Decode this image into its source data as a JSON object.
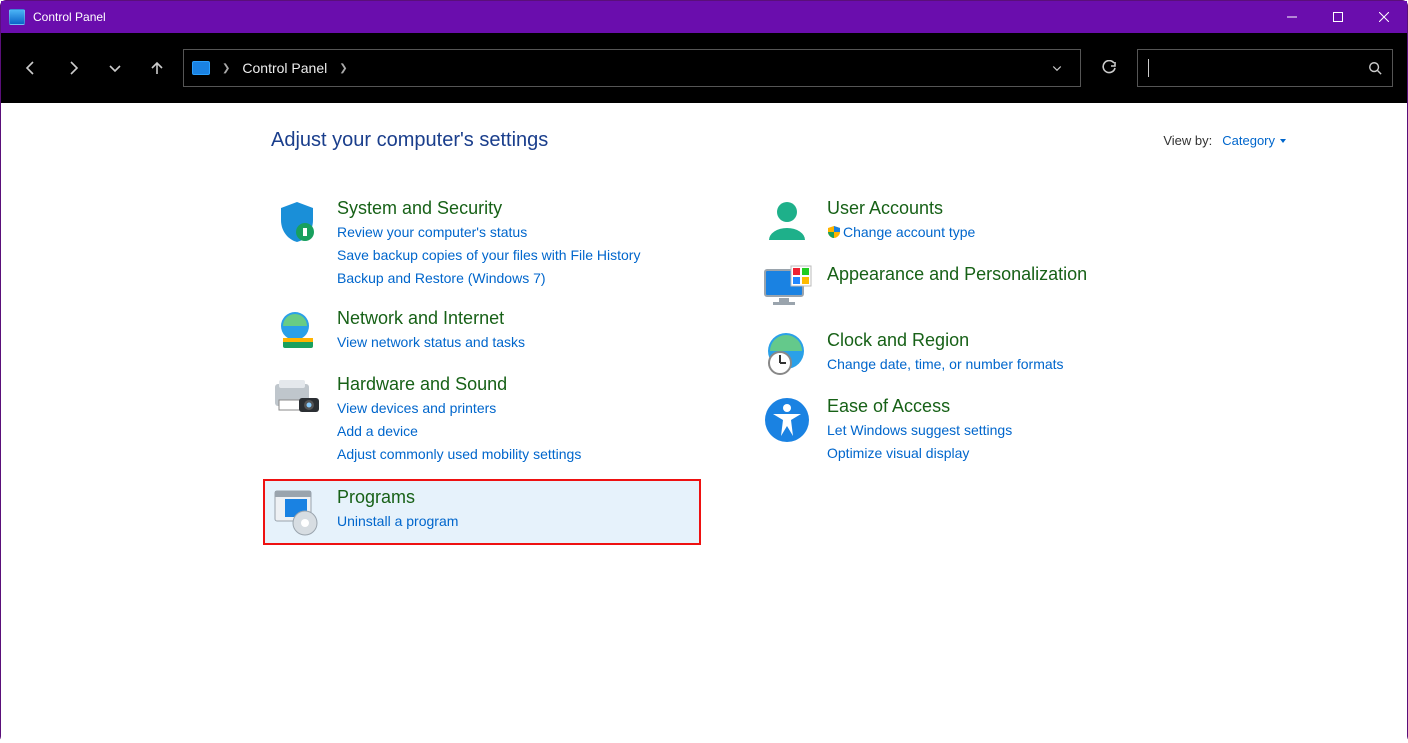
{
  "window_title": "Control Panel",
  "breadcrumb": {
    "root": "Control Panel"
  },
  "heading": "Adjust your computer's settings",
  "view_by": {
    "label": "View by:",
    "value": "Category"
  },
  "categories": {
    "system_security": {
      "title": "System and Security",
      "links": [
        "Review your computer's status",
        "Save backup copies of your files with File History",
        "Backup and Restore (Windows 7)"
      ]
    },
    "network": {
      "title": "Network and Internet",
      "links": [
        "View network status and tasks"
      ]
    },
    "hardware": {
      "title": "Hardware and Sound",
      "links": [
        "View devices and printers",
        "Add a device",
        "Adjust commonly used mobility settings"
      ]
    },
    "programs": {
      "title": "Programs",
      "links": [
        "Uninstall a program"
      ]
    },
    "users": {
      "title": "User Accounts",
      "links": [
        "Change account type"
      ]
    },
    "appearance": {
      "title": "Appearance and Personalization",
      "links": []
    },
    "clock": {
      "title": "Clock and Region",
      "links": [
        "Change date, time, or number formats"
      ]
    },
    "ease": {
      "title": "Ease of Access",
      "links": [
        "Let Windows suggest settings",
        "Optimize visual display"
      ]
    }
  }
}
